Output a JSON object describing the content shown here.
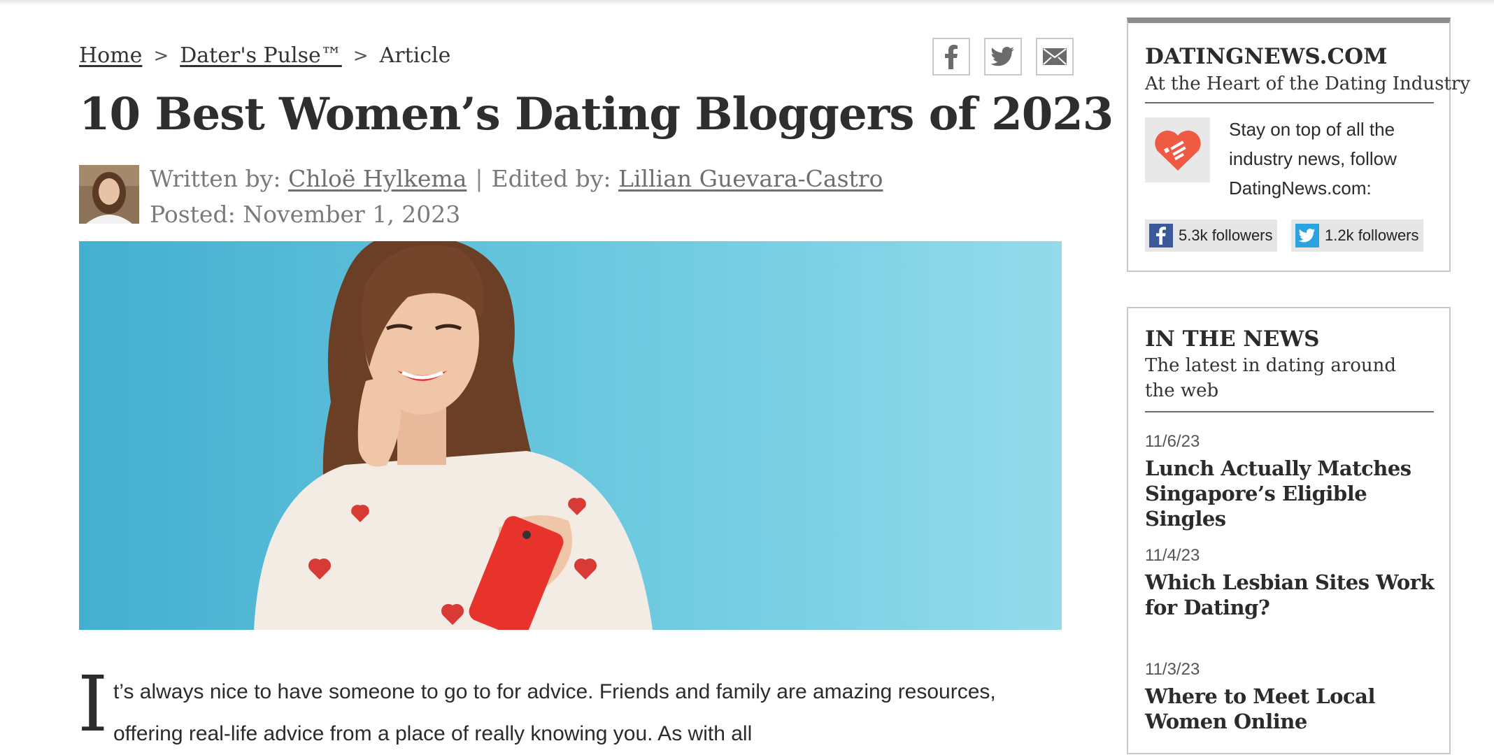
{
  "breadcrumb": {
    "home": "Home",
    "section": "Dater's Pulse™",
    "current": "Article",
    "separator": ">"
  },
  "share": {
    "icons": [
      "facebook-icon",
      "twitter-icon",
      "email-icon"
    ]
  },
  "article": {
    "title": "10 Best Women’s Dating Bloggers of 2023",
    "written_by_label": "Written by:",
    "author": "Chloë Hylkema",
    "pipe": "|",
    "edited_by_label": "Edited by:",
    "editor": "Lillian Guevara-Castro",
    "posted": "Posted: November 1, 2023",
    "dropcap": "I",
    "paragraph": "t’s always nice to have someone to go to for advice. Friends and family are amazing resources, offering real-life advice from a place of really knowing you. As with all"
  },
  "sidebar": {
    "brand": "DATINGNEWS.COM",
    "tagline": "At the Heart of the Dating Industry",
    "follow_text": "Stay on top of all the industry news, follow DatingNews.com:",
    "facebook_followers": "5.3k followers",
    "twitter_followers": "1.2k followers",
    "news_heading": "IN THE NEWS",
    "news_subheading": "The latest in dating around the web",
    "news": [
      {
        "date": "11/6/23",
        "headline": "Lunch Actually Matches Singapore’s Eligible Singles"
      },
      {
        "date": "11/4/23",
        "headline": "Which Lesbian Sites Work for Dating?"
      },
      {
        "date": "11/3/23",
        "headline": "Where to Meet Local Women Online"
      }
    ]
  },
  "colors": {
    "hero_background": "#6ccae0",
    "facebook": "#3b5998",
    "twitter": "#2aa3e0",
    "logo_heart": "#ef5a43"
  }
}
